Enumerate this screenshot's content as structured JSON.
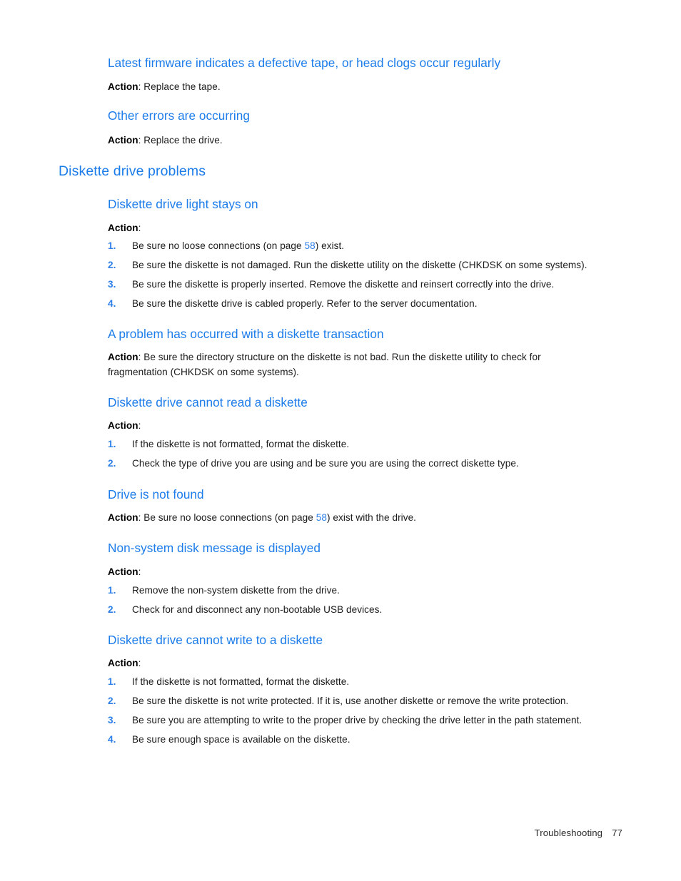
{
  "page": {
    "footer_section": "Troubleshooting",
    "footer_page_number": "77",
    "heading_color": "#1C7CEA",
    "link_color": "#2D7FE8",
    "body_color": "#1a1a1a",
    "background": "#ffffff"
  },
  "sections": [
    {
      "id": "latest-firmware",
      "level": "h3",
      "heading": "Latest firmware indicates a defective tape, or head clogs occur regularly",
      "action_label": "Action",
      "action_sep": ": ",
      "action_text": "Replace the tape."
    },
    {
      "id": "other-errors",
      "level": "h3",
      "heading": "Other errors are occurring",
      "action_label": "Action",
      "action_sep": ": ",
      "action_text": "Replace the drive."
    },
    {
      "id": "diskette-drive-problems",
      "level": "h2",
      "heading": "Diskette drive problems"
    },
    {
      "id": "diskette-light-stays-on",
      "level": "h3",
      "heading": "Diskette drive light stays on",
      "action_label": "Action",
      "action_sep": ":",
      "steps": [
        {
          "num": "1.",
          "pre": "Be sure no loose connections (on page ",
          "xref": "58",
          "post": ") exist."
        },
        {
          "num": "2.",
          "pre": "Be sure the diskette is not damaged. Run the diskette utility on the diskette (CHKDSK on some systems)."
        },
        {
          "num": "3.",
          "pre": "Be sure the diskette is properly inserted. Remove the diskette and reinsert correctly into the drive."
        },
        {
          "num": "4.",
          "pre": "Be sure the diskette drive is cabled properly. Refer to the server documentation."
        }
      ]
    },
    {
      "id": "problem-diskette-transaction",
      "level": "h3",
      "heading": "A problem has occurred with a diskette transaction",
      "action_label": "Action",
      "action_sep": ": ",
      "action_text": "Be sure the directory structure on the diskette is not bad. Run the diskette utility to check for fragmentation (CHKDSK on some systems)."
    },
    {
      "id": "cannot-read-diskette",
      "level": "h3",
      "heading": "Diskette drive cannot read a diskette",
      "action_label": "Action",
      "action_sep": ":",
      "steps": [
        {
          "num": "1.",
          "pre": "If the diskette is not formatted, format the diskette."
        },
        {
          "num": "2.",
          "pre": "Check the type of drive you are using and be sure you are using the correct diskette type."
        }
      ]
    },
    {
      "id": "drive-not-found",
      "level": "h3",
      "heading": "Drive is not found",
      "action_label": "Action",
      "action_sep": ": ",
      "action_pre": "Be sure no loose connections (on page ",
      "action_xref": "58",
      "action_post": ") exist with the drive."
    },
    {
      "id": "non-system-disk",
      "level": "h3",
      "heading": "Non-system disk message is displayed",
      "action_label": "Action",
      "action_sep": ":",
      "steps": [
        {
          "num": "1.",
          "pre": "Remove the non-system diskette from the drive."
        },
        {
          "num": "2.",
          "pre": "Check for and disconnect any non-bootable USB devices."
        }
      ]
    },
    {
      "id": "cannot-write-diskette",
      "level": "h3",
      "heading": "Diskette drive cannot write to a diskette",
      "action_label": "Action",
      "action_sep": ":",
      "steps": [
        {
          "num": "1.",
          "pre": "If the diskette is not formatted, format the diskette."
        },
        {
          "num": "2.",
          "pre": "Be sure the diskette is not write protected. If it is, use another diskette or remove the write protection."
        },
        {
          "num": "3.",
          "pre": "Be sure you are attempting to write to the proper drive by checking the drive letter in the path statement."
        },
        {
          "num": "4.",
          "pre": "Be sure enough space is available on the diskette."
        }
      ]
    }
  ]
}
